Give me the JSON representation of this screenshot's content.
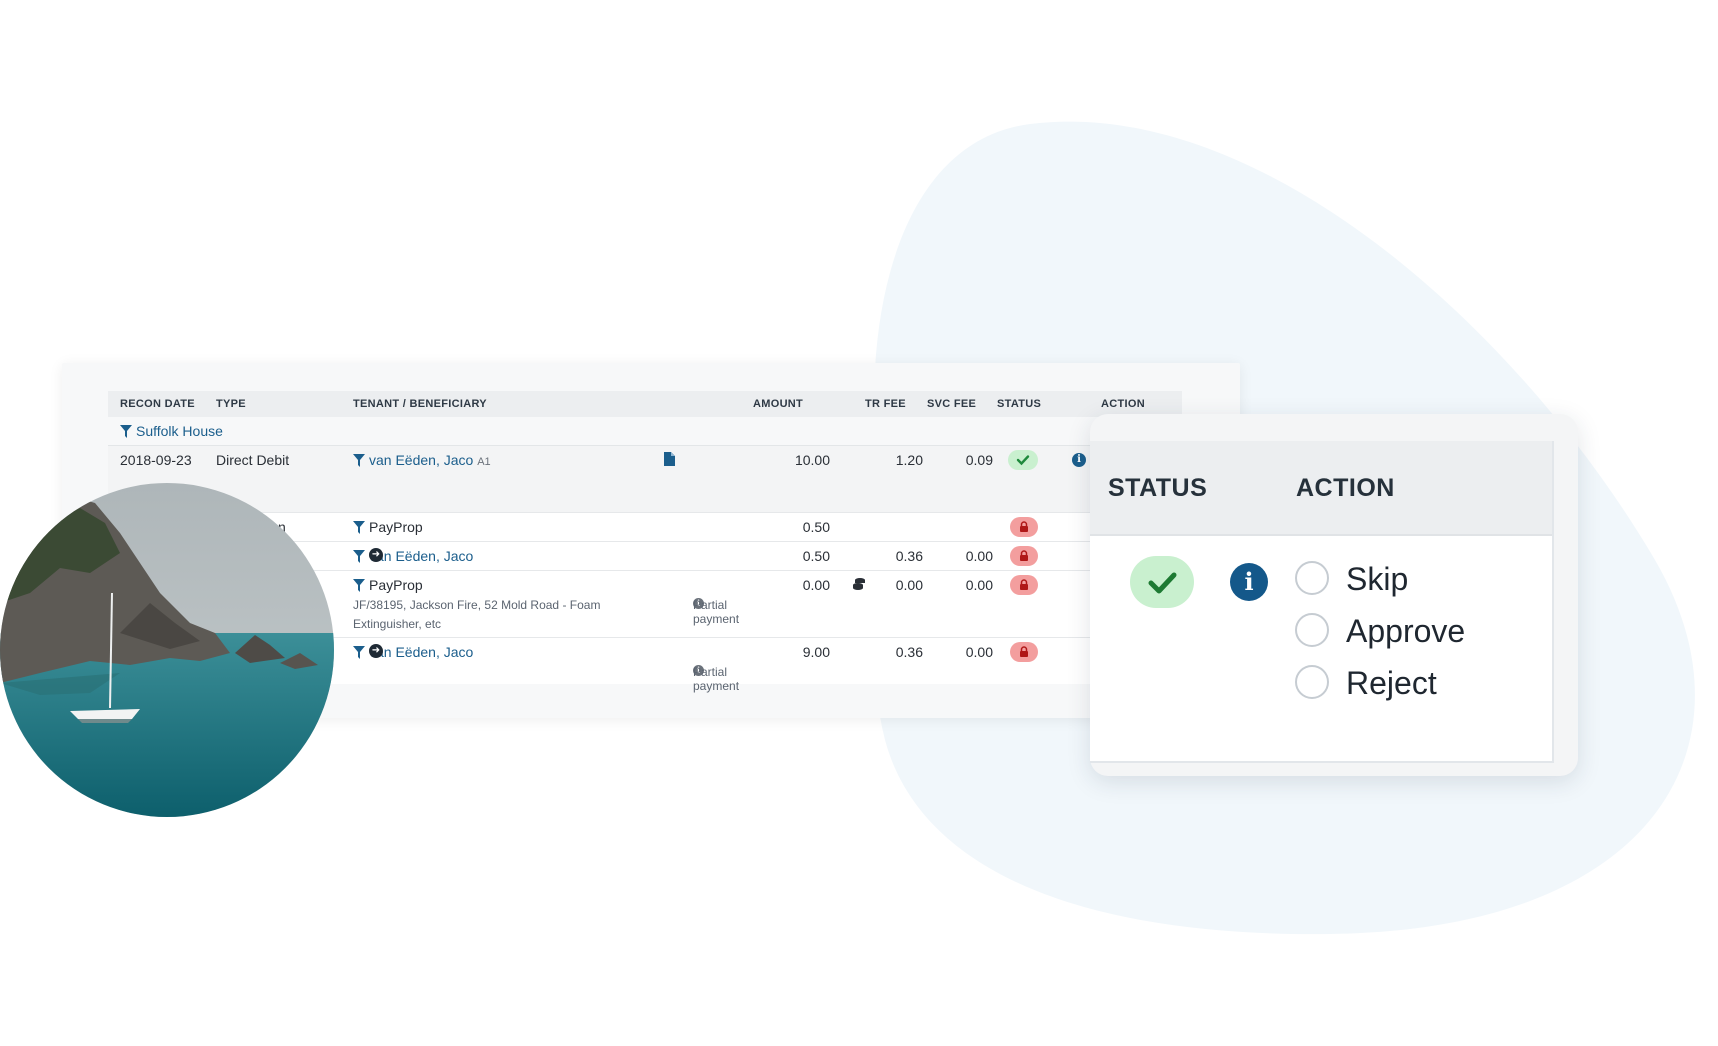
{
  "table": {
    "headers": {
      "recon_date": "RECON DATE",
      "type": "TYPE",
      "tenant": "TENANT / BENEFICIARY",
      "amount": "AMOUNT",
      "tr_fee": "TR FEE",
      "svc_fee": "SVC FEE",
      "status": "STATUS",
      "action": "ACTION"
    },
    "group_label": "Suffolk House",
    "rows": [
      {
        "date": "2018-09-23",
        "type": "Direct Debit",
        "name": "van Eëden, Jaco",
        "unit": "A1",
        "amount": "10.00",
        "tr_fee": "1.20",
        "svc_fee": "0.09",
        "status": "ok"
      },
      {
        "type": "ission",
        "name": "PayProp",
        "amount": "0.50",
        "status": "locked"
      },
      {
        "name": "van Eëden, Jaco",
        "amount": "0.50",
        "tr_fee": "0.36",
        "svc_fee": "0.00",
        "status": "locked"
      },
      {
        "name": "PayProp",
        "detail": "JF/38195, Jackson Fire, 52 Mold Road - Foam Extinguisher, etc",
        "detail_line1": "JF/38195, Jackson Fire, 52 Mold Road - Foam",
        "detail_line2": "Extinguisher, etc",
        "note": "Partial payment",
        "amount": "0.00",
        "tr_fee": "0.00",
        "svc_fee": "0.00",
        "status": "locked"
      },
      {
        "name": "van Eëden, Jaco",
        "note": "Partial payment",
        "amount": "9.00",
        "tr_fee": "0.36",
        "svc_fee": "0.00",
        "status": "locked"
      }
    ]
  },
  "zoom": {
    "status_label": "STATUS",
    "action_label": "ACTION",
    "options": [
      "Skip",
      "Approve",
      "Reject"
    ]
  },
  "colors": {
    "link": "#1b5e8c",
    "ok_bg": "#c9f0cf",
    "ok_check": "#1e8a3c",
    "lock_bg": "#f39e9e",
    "blob": "#f1f7fb"
  },
  "icons": [
    "filter-icon",
    "document-icon",
    "check-icon",
    "info-icon",
    "lock-icon",
    "arrow-circle-icon",
    "coins-icon"
  ]
}
